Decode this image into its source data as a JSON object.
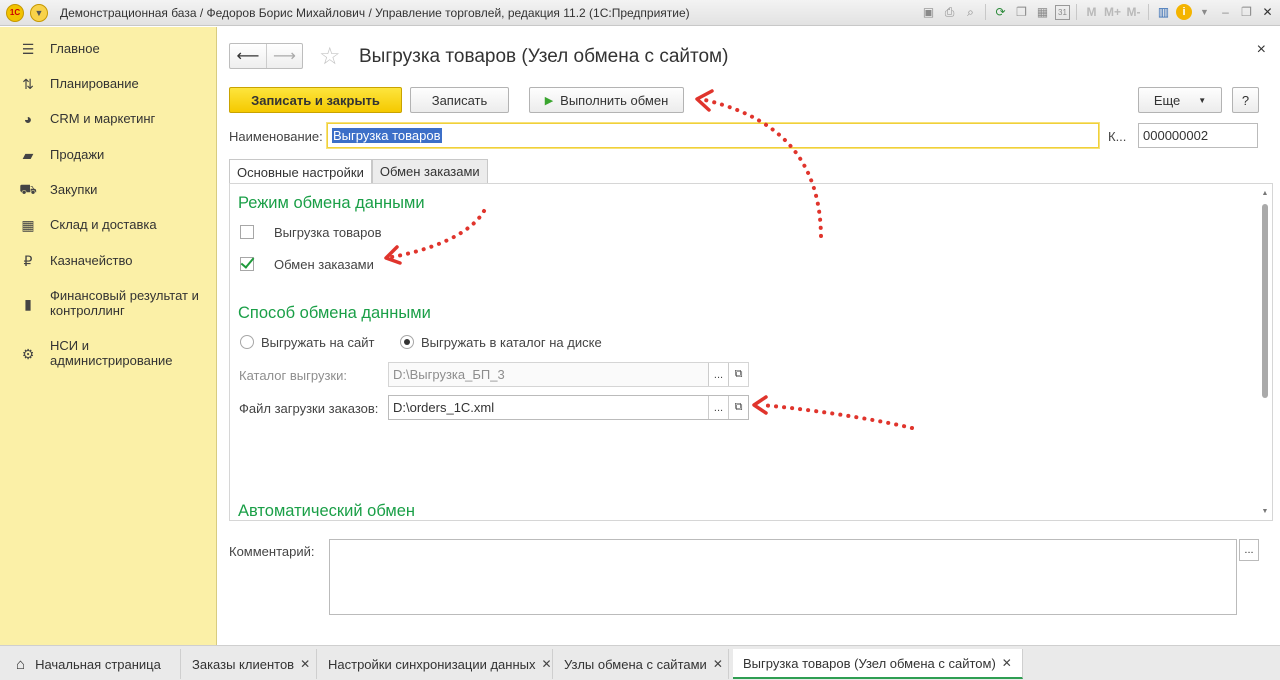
{
  "window": {
    "title": "Демонстрационная база / Федоров Борис Михайлович / Управление торговлей, редакция 11.2  (1С:Предприятие)",
    "toolbar_icons": [
      "save-icon",
      "print-icon",
      "search-icon",
      "refresh-icon",
      "copy-icon",
      "calculator-icon",
      "calendar-icon",
      "m-icon",
      "m-plus-icon",
      "m-minus-icon",
      "panel-icon",
      "info-icon",
      "dropdown-icon",
      "minimize-icon",
      "restore-icon",
      "close-icon"
    ],
    "m_labels": [
      "M",
      "M+",
      "M-"
    ],
    "calendar_day": "31"
  },
  "sidebar": {
    "items": [
      {
        "label": "Главное",
        "icon": "menu-icon"
      },
      {
        "label": "Планирование",
        "icon": "planning-icon"
      },
      {
        "label": "CRM и маркетинг",
        "icon": "pie-chart-icon"
      },
      {
        "label": "Продажи",
        "icon": "shopping-bag-icon"
      },
      {
        "label": "Закупки",
        "icon": "cart-icon"
      },
      {
        "label": "Склад и доставка",
        "icon": "warehouse-icon"
      },
      {
        "label": "Казначейство",
        "icon": "ruble-icon"
      },
      {
        "label": "Финансовый результат и контроллинг",
        "icon": "bar-chart-icon"
      },
      {
        "label": "НСИ и администрирование",
        "icon": "gear-icon"
      }
    ]
  },
  "form": {
    "title": "Выгрузка товаров (Узел обмена с сайтом)",
    "close": "×",
    "buttons": {
      "save_close": "Записать и закрыть",
      "save": "Записать",
      "run_exchange": "Выполнить обмен",
      "more": "Еще",
      "help": "?"
    },
    "name_label": "Наименование:",
    "name_value": "Выгрузка товаров",
    "code_label": "К...",
    "code_value": "000000002",
    "tabs": [
      "Основные настройки",
      "Обмен заказами"
    ],
    "mode_section": "Режим обмена данными",
    "chk_export_goods": "Выгрузка товаров",
    "chk_export_goods_checked": false,
    "chk_orders": "Обмен заказами",
    "chk_orders_checked": true,
    "method_section": "Способ обмена данными",
    "radio_site": "Выгружать на сайт",
    "radio_dir": "Выгружать в каталог на диске",
    "radio_selected": "Выгружать в каталог на диске",
    "catalog_label": "Каталог выгрузки:",
    "catalog_value": "D:\\Выгрузка_БП_3",
    "orders_file_label": "Файл загрузки заказов:",
    "orders_file_value": "D:\\orders_1C.xml",
    "auto_section": "Автоматический обмен",
    "comment_label": "Комментарий:",
    "comment_value": "",
    "ellipsis": "..."
  },
  "bottom_tabs": [
    {
      "label": "Начальная страница",
      "active": false
    },
    {
      "label": "Заказы клиентов",
      "active": false
    },
    {
      "label": "Настройки синхронизации данных",
      "active": false
    },
    {
      "label": "Узлы обмена с сайтами",
      "active": false
    },
    {
      "label": "Выгрузка товаров (Узел обмена с сайтом)",
      "active": true
    }
  ],
  "colors": {
    "sidebar_bg": "#fbf0a7",
    "primary_button": "#f5c900",
    "section_title": "#1a9f47",
    "annotation_arrow": "#e0342c",
    "active_tab_underline": "#2f9e52"
  }
}
